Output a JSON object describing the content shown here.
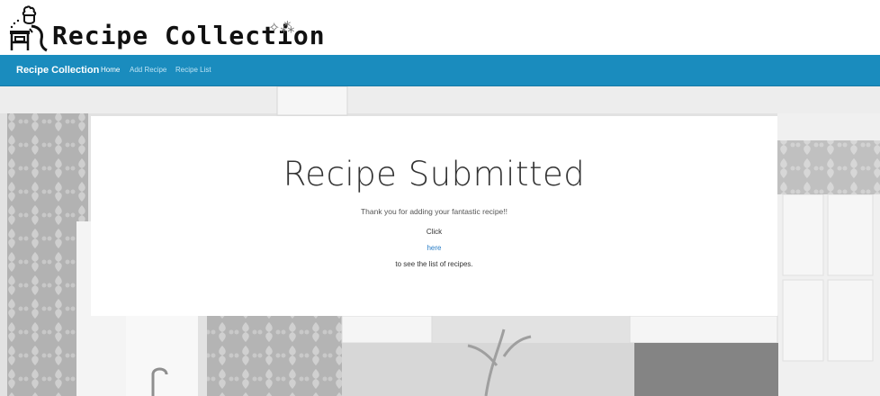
{
  "logo": {
    "title": "Recipe Collection",
    "icon": "chef-cooking-icon",
    "sparkle_icon": "sparkle-icon"
  },
  "navbar": {
    "brand": "Recipe Collection",
    "links": [
      {
        "label": "Home",
        "active": true
      },
      {
        "label": "Add Recipe",
        "active": false
      },
      {
        "label": "Recipe List",
        "active": false
      }
    ],
    "color": "#1a8cbe"
  },
  "main": {
    "title": "Recipe Submitted",
    "thanks": "Thank you for adding your fantastic recipe!!",
    "click": "Click",
    "here_link": "here",
    "to_see": "to see the list of recipes.",
    "link_color": "#2a7ec7"
  }
}
